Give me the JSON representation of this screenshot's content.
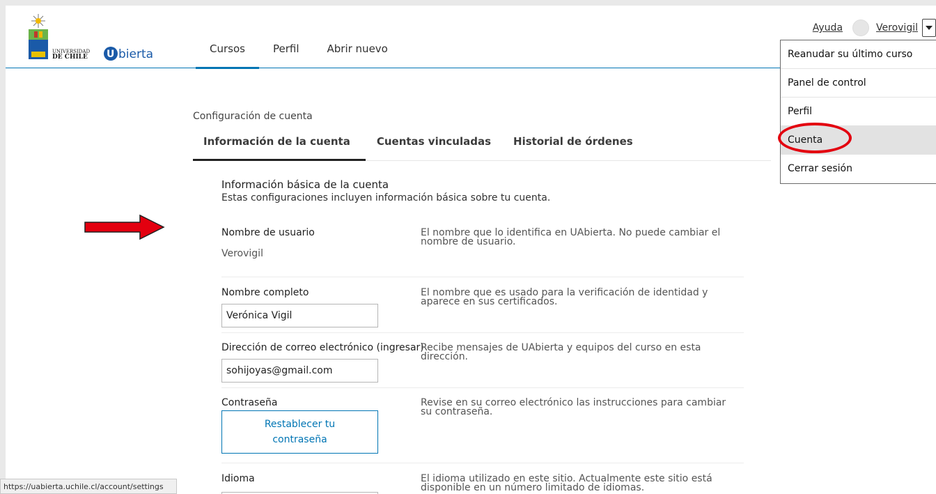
{
  "header": {
    "brand_univ_line1": "UNIVERSIDAD",
    "brand_univ_line2": "DE CHILE",
    "brand_uabierta": "Uabierta",
    "nav": [
      "Cursos",
      "Perfil",
      "Abrir nuevo"
    ],
    "help": "Ayuda",
    "username": "Verovigil"
  },
  "dropdown": {
    "items": [
      "Reanudar su último curso",
      "Panel de control",
      "Perfil",
      "Cuenta",
      "Cerrar sesión"
    ]
  },
  "settings": {
    "title": "Configuración de cuenta",
    "tabs": [
      "Información de la cuenta",
      "Cuentas vinculadas",
      "Historial de órdenes"
    ],
    "section_heading": "Información básica de la cuenta",
    "section_desc": "Estas configuraciones incluyen información básica sobre tu cuenta.",
    "username": {
      "label": "Nombre de usuario",
      "value": "Verovigil",
      "help": "El nombre que lo identifica en UAbierta. No puede cambiar el nombre de usuario."
    },
    "fullname": {
      "label": "Nombre completo",
      "value": "Verónica Vigil",
      "help": "El nombre que es usado para la verificación de identidad y aparece en sus certificados."
    },
    "email": {
      "label": "Dirección de correo electrónico (ingresar)",
      "value": "sohijoyas@gmail.com",
      "help": "Recibe mensajes de UAbierta y equipos del curso en esta dirección."
    },
    "password": {
      "label": "Contraseña",
      "button": "Restablecer tu contraseña",
      "help": "Revise en su correo electrónico las instrucciones para cambiar su contraseña."
    },
    "language": {
      "label": "Idioma",
      "help": "El idioma utilizado en este sitio. Actualmente este sitio está disponible en un número limitado de idiomas."
    }
  },
  "status_bar": "https://uabierta.uchile.cl/account/settings",
  "colors": {
    "accent": "#0075b4",
    "annotation_red": "#e3000f"
  }
}
